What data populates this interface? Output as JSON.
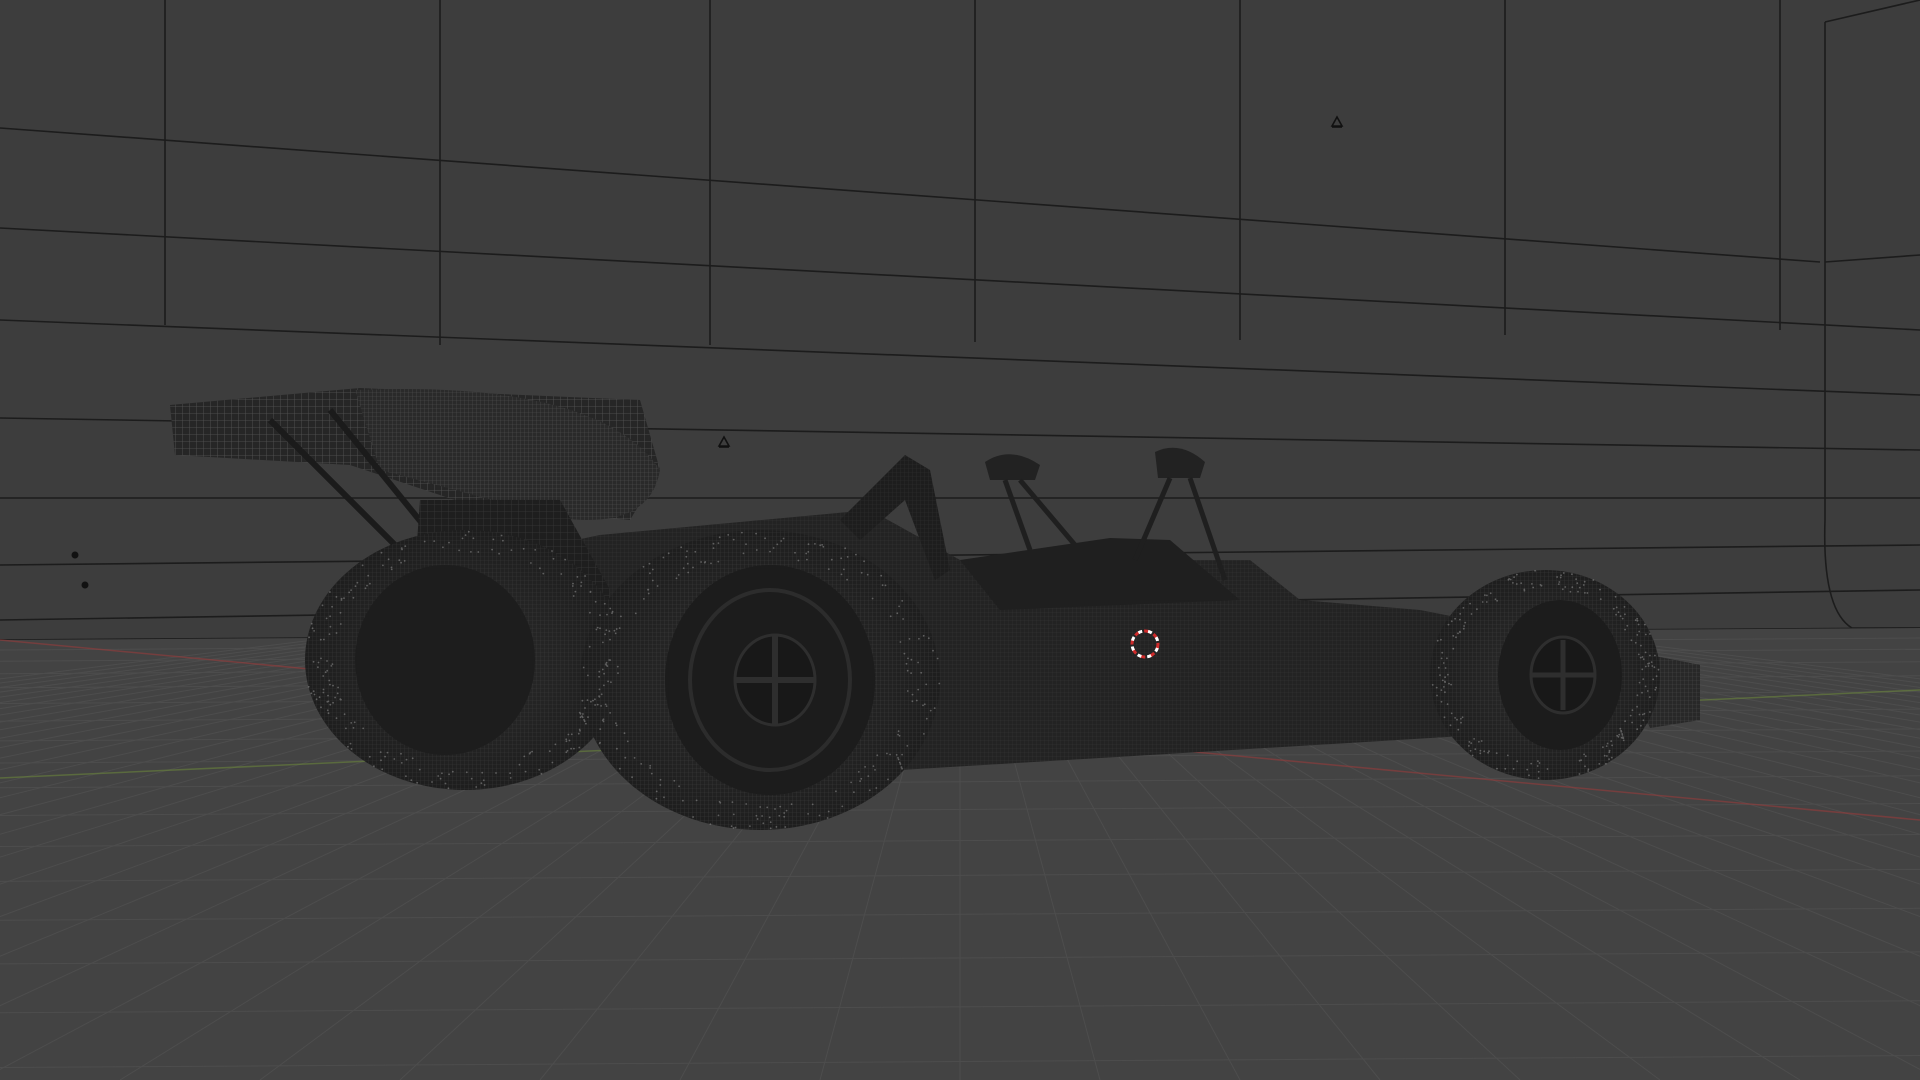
{
  "viewport": {
    "kind": "3d-viewport",
    "shading": "wireframe-overlay",
    "background_color": "#3c3c3c",
    "floor_color": "#434343",
    "backdrop_color": "#3d3d3d",
    "grid_line_color": "#4d4d4d",
    "backdrop_line_color": "#1c1c1c",
    "x_axis_color": "#9e3a3a",
    "y_axis_color": "#6d8a3a",
    "model_color": "#242424",
    "wire_color": "#6a6a6a"
  },
  "scene": {
    "model": {
      "name": "race-car",
      "icon": "race-car-wireframe"
    },
    "cursor": {
      "icon": "3d-cursor-icon",
      "colors": [
        "#d02a2a",
        "#ffffff"
      ]
    },
    "empties": [
      {
        "icon": "light-icon"
      },
      {
        "icon": "light-icon"
      },
      {
        "icon": "light-icon"
      },
      {
        "icon": "light-icon"
      }
    ]
  }
}
